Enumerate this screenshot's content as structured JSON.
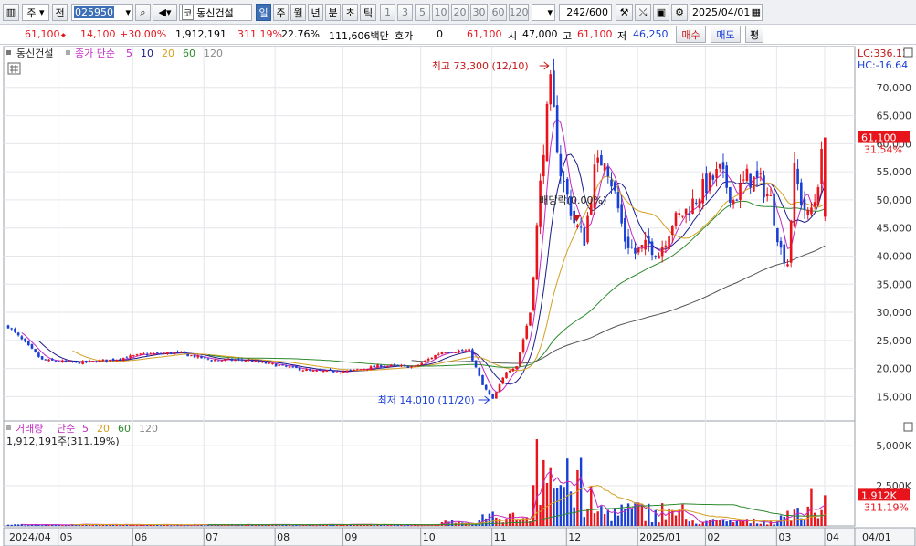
{
  "toolbar": {
    "market": "주",
    "prev_label": "전",
    "code": "025950",
    "search": "코",
    "stock_name": "동신건설",
    "periods": [
      "일",
      "주",
      "월",
      "년",
      "분",
      "초",
      "틱"
    ],
    "intervals": [
      "1",
      "3",
      "5",
      "10",
      "20",
      "30",
      "60",
      "120"
    ],
    "count": "242",
    "total": "/600",
    "date": "2025/04/01"
  },
  "quote": {
    "price": "61,100",
    "change": "14,100",
    "rate": "+30.00%",
    "volume": "1,912,191",
    "vol_rate": "311.19%",
    "turnover": "22.76%",
    "amount": "111,606백만",
    "hoga_label": "호가",
    "hoga_val": "0",
    "hoga_price": "61,100",
    "open_label": "시",
    "open": "47,000",
    "high_label": "고",
    "high": "61,100",
    "low_label": "저",
    "low": "46,250",
    "buy": "매수",
    "sell": "매도",
    "avg": "평"
  },
  "legend": {
    "name": "동신건설",
    "ma_label": "종가 단순",
    "ma_periods": [
      "5",
      "10",
      "20",
      "60",
      "120"
    ]
  },
  "vol_legend": {
    "label": "거래량",
    "ma_label": "단순",
    "ma_periods": [
      "5",
      "20",
      "60",
      "120"
    ],
    "value": "1,912,191주(311.19%)"
  },
  "right": {
    "lc": "LC:336.12",
    "hc": "HC:-16.64",
    "price_tag": "61,100",
    "pct_tag": "31.54%",
    "vol_tag": "1,912K",
    "vol_pct": "311.19%"
  },
  "annotations": {
    "high": "최고 73,300 (12/10)",
    "low": "최저 14,010 (11/20)",
    "marker": "배당락(0.00%)"
  },
  "colors": {
    "up": "#e8141c",
    "down": "#1a3fd6",
    "ma5": "#c22ac2",
    "ma10": "#1a1a8a",
    "ma20": "#d4a020",
    "ma60": "#2d8a2d",
    "ma120": "#555555"
  },
  "chart_data": {
    "type": "candlestick",
    "y_ticks": [
      70000,
      65000,
      60000,
      55000,
      50000,
      45000,
      40000,
      35000,
      30000,
      25000,
      20000,
      15000
    ],
    "y_tick_labels": [
      "70,000",
      "65,000",
      "60,000",
      "55,000",
      "50,000",
      "45,000",
      "40,000",
      "35,000",
      "30,000",
      "25,000",
      "20,000",
      "15,000"
    ],
    "ylim": [
      11000,
      75000
    ],
    "vol_ticks": [
      "5,000K",
      "2,500K"
    ],
    "vol_tick_values": [
      5000000,
      2500000
    ],
    "vol_ylim": [
      0,
      5800000
    ],
    "x_labels": [
      "2024/04",
      "05",
      "06",
      "07",
      "08",
      "09",
      "10",
      "11",
      "12",
      "2025/01",
      "02",
      "03",
      "04",
      "04/01"
    ],
    "anchors": [
      {
        "i": 0,
        "v": 27500
      },
      {
        "i": 10,
        "v": 21500
      },
      {
        "i": 20,
        "v": 21000
      },
      {
        "i": 30,
        "v": 21500
      },
      {
        "i": 40,
        "v": 22500
      },
      {
        "i": 50,
        "v": 22800
      },
      {
        "i": 60,
        "v": 21500
      },
      {
        "i": 70,
        "v": 21500
      },
      {
        "i": 80,
        "v": 20500
      },
      {
        "i": 90,
        "v": 19500
      },
      {
        "i": 100,
        "v": 19500
      },
      {
        "i": 110,
        "v": 20500
      },
      {
        "i": 120,
        "v": 20300
      },
      {
        "i": 128,
        "v": 23000
      },
      {
        "i": 136,
        "v": 23200
      },
      {
        "i": 140,
        "v": 17000
      },
      {
        "i": 143,
        "v": 14500
      },
      {
        "i": 147,
        "v": 19500
      },
      {
        "i": 150,
        "v": 20500
      },
      {
        "i": 154,
        "v": 30000
      },
      {
        "i": 158,
        "v": 60000
      },
      {
        "i": 160,
        "v": 70000
      },
      {
        "i": 163,
        "v": 55000
      },
      {
        "i": 167,
        "v": 46000
      },
      {
        "i": 170,
        "v": 43000
      },
      {
        "i": 173,
        "v": 55000
      },
      {
        "i": 176,
        "v": 58000
      },
      {
        "i": 179,
        "v": 51000
      },
      {
        "i": 182,
        "v": 43000
      },
      {
        "i": 185,
        "v": 40500
      },
      {
        "i": 189,
        "v": 42000
      },
      {
        "i": 192,
        "v": 40500
      },
      {
        "i": 196,
        "v": 46000
      },
      {
        "i": 200,
        "v": 48000
      },
      {
        "i": 205,
        "v": 52000
      },
      {
        "i": 210,
        "v": 55000
      },
      {
        "i": 214,
        "v": 50000
      },
      {
        "i": 218,
        "v": 54000
      },
      {
        "i": 222,
        "v": 53000
      },
      {
        "i": 225,
        "v": 50000
      },
      {
        "i": 228,
        "v": 41000
      },
      {
        "i": 230,
        "v": 39000
      },
      {
        "i": 232,
        "v": 55000
      },
      {
        "i": 234,
        "v": 50000
      },
      {
        "i": 236,
        "v": 47000
      },
      {
        "i": 238,
        "v": 50000
      },
      {
        "i": 241,
        "v": 61100
      }
    ],
    "count": 242
  }
}
